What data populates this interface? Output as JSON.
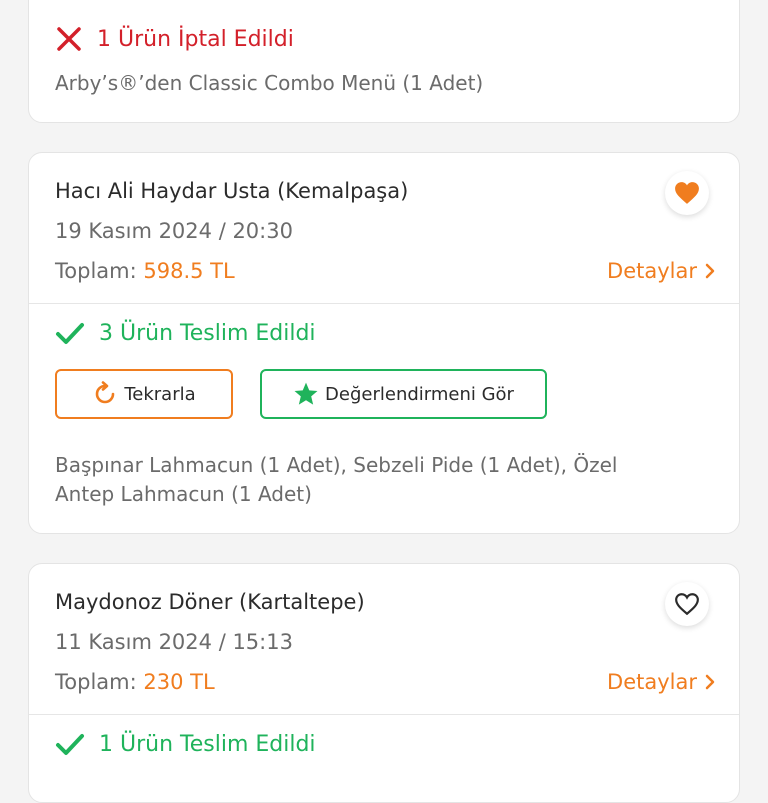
{
  "card1": {
    "status": "1 Ürün İptal Edildi",
    "items": "Arby’s®’den Classic Combo Menü (1 Adet)"
  },
  "card2": {
    "shop": "Hacı Ali Haydar Usta (Kemalpaşa)",
    "date": "19 Kasım 2024 / 20:30",
    "total_label": "Toplam:",
    "total_amount": "598.5 TL",
    "details_label": "Detaylar",
    "favorite": true,
    "status": "3 Ürün Teslim Edildi",
    "repeat_label": "Tekrarla",
    "review_label": "Değerlendirmeni Gör",
    "items": "Başpınar Lahmacun (1 Adet), Sebzeli Pide (1 Adet), Özel Antep Lahmacun (1 Adet)"
  },
  "card3": {
    "shop": "Maydonoz Döner (Kartaltepe)",
    "date": "11 Kasım 2024 / 15:13",
    "total_label": "Toplam:",
    "total_amount": "230 TL",
    "details_label": "Detaylar",
    "favorite": false,
    "status": "1 Ürün Teslim Edildi"
  },
  "colors": {
    "accent_orange": "#f07d1f",
    "success_green": "#1fb35b",
    "cancel_red": "#d3202a"
  },
  "icons": {
    "cancel": "close-icon",
    "delivered": "check-icon",
    "favorite_filled": "heart-filled-icon",
    "favorite_empty": "heart-outline-icon",
    "repeat": "refresh-icon",
    "review": "star-icon",
    "chevron": "chevron-right-icon"
  }
}
